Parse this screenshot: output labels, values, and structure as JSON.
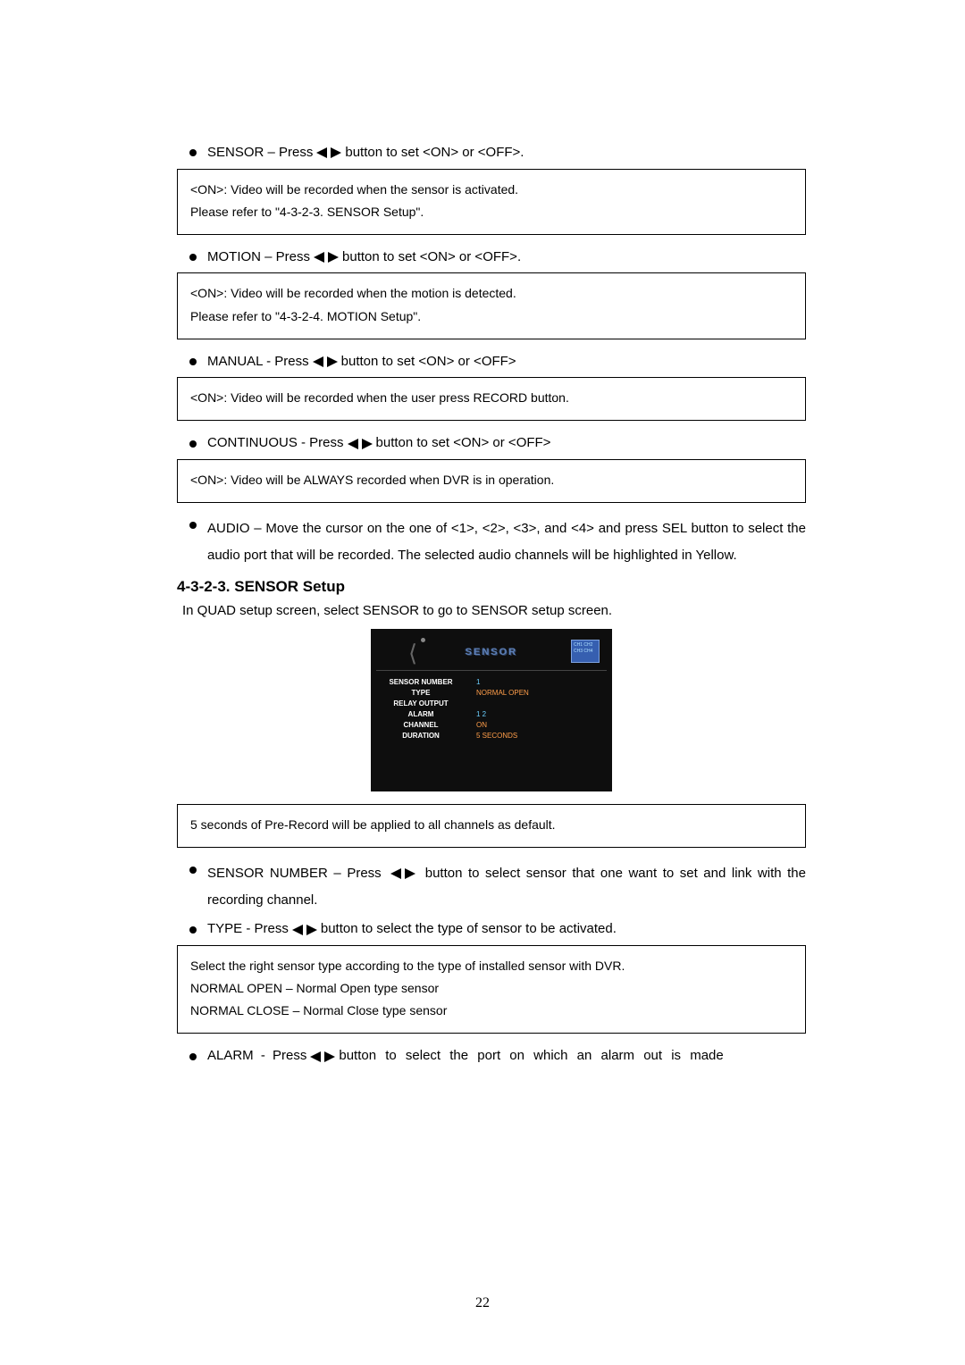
{
  "sensor": {
    "label_pre": "SENSOR – Press ",
    "label_post": " button to set <ON> or <OFF>.",
    "box_l1": "<ON>: Video will be recorded when the sensor is activated.",
    "box_l2": "Please refer to \"4-3-2-3. SENSOR Setup\"."
  },
  "motion": {
    "label_pre": "MOTION – Press ",
    "label_post": " button to set <ON> or <OFF>.",
    "box_l1": "<ON>: Video will be recorded when the motion is detected.",
    "box_l2": "Please refer to \"4-3-2-4. MOTION Setup\"."
  },
  "manual": {
    "label_pre": "MANUAL - Press ",
    "label_post": " button to set <ON> or <OFF>",
    "box_l1": "<ON>: Video will be recorded when the user press RECORD button."
  },
  "continuous": {
    "label_pre": "CONTINUOUS - Press ",
    "label_post": " button to set <ON> or <OFF>",
    "box_l1": "<ON>: Video will be ALWAYS recorded when DVR is in operation."
  },
  "audio": {
    "text": "AUDIO – Move the cursor on the one of <1>, <2>, <3>, and <4> and press SEL button to select the audio port that will be recorded. The selected audio channels will be highlighted in Yellow."
  },
  "section": {
    "header": "4-3-2-3. SENSOR Setup",
    "intro": "In QUAD setup screen, select SENSOR to go to SENSOR setup screen."
  },
  "screenshot": {
    "title": "SENSOR",
    "badge_l1": "CH1 CH2",
    "badge_l2": "CH3 CH4",
    "rows": {
      "r0_label": "SENSOR NUMBER",
      "r0_val": "1",
      "r1_label": "TYPE",
      "r1_val": "NORMAL OPEN",
      "r2_label": "RELAY OUTPUT",
      "r2_val": "",
      "r3_label": "ALARM",
      "r3_val": "1   2",
      "r4_label": "CHANNEL",
      "r4_val": "ON",
      "r5_label": "DURATION",
      "r5_val": "5 SECONDS"
    }
  },
  "prerecord_box": "5 seconds of Pre-Record will be applied to all channels as default.",
  "sensor_number": {
    "label_pre": "SENSOR NUMBER – Press ",
    "label_post": " button to select sensor that one want to set and link with the recording channel."
  },
  "type": {
    "label_pre": "TYPE - Press ",
    "label_post": " button to select the type of sensor to be activated.",
    "box_l1": "Select the right sensor type according to the type of installed sensor with DVR.",
    "box_l2": "NORMAL OPEN – Normal Open type sensor",
    "box_l3": "NORMAL CLOSE – Normal Close type sensor"
  },
  "alarm": {
    "label_pre": "ALARM - Press ",
    "label_post": " button to select the port on which an alarm out is made"
  },
  "page_num": "22"
}
